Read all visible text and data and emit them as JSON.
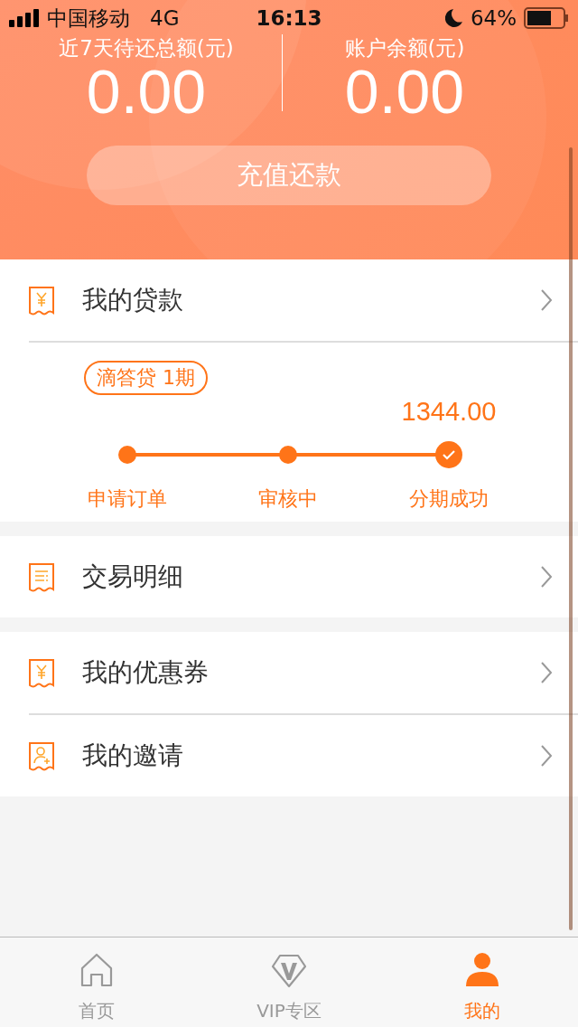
{
  "status_bar": {
    "carrier": "中国移动",
    "network": "4G",
    "time": "16:13",
    "battery": "64%"
  },
  "summary": {
    "stats": [
      {
        "label": "近7天待还总额(元)",
        "value": "0.00"
      },
      {
        "label": "账户余额(元)",
        "value": "0.00"
      }
    ],
    "button": "充值还款"
  },
  "loan": {
    "title": "我的贷款",
    "kind": "yen",
    "tag": "滴答贷 1期",
    "amount": "1344.00",
    "steps": [
      {
        "label": "申请订单",
        "kind": "dot"
      },
      {
        "label": "审核中",
        "kind": "dot"
      },
      {
        "label": "分期成功",
        "kind": "check"
      }
    ]
  },
  "menu_groups": [
    [
      {
        "title": "交易明细",
        "kind": "lines"
      }
    ],
    [
      {
        "title": "我的优惠券",
        "kind": "yen"
      },
      {
        "title": "我的邀请",
        "kind": "person"
      }
    ]
  ],
  "tab_bar": [
    {
      "label": "首页",
      "kind": "home",
      "selected": false
    },
    {
      "label": "VIP专区",
      "kind": "vip",
      "selected": false
    },
    {
      "label": "我的",
      "kind": "person",
      "selected": true
    }
  ]
}
